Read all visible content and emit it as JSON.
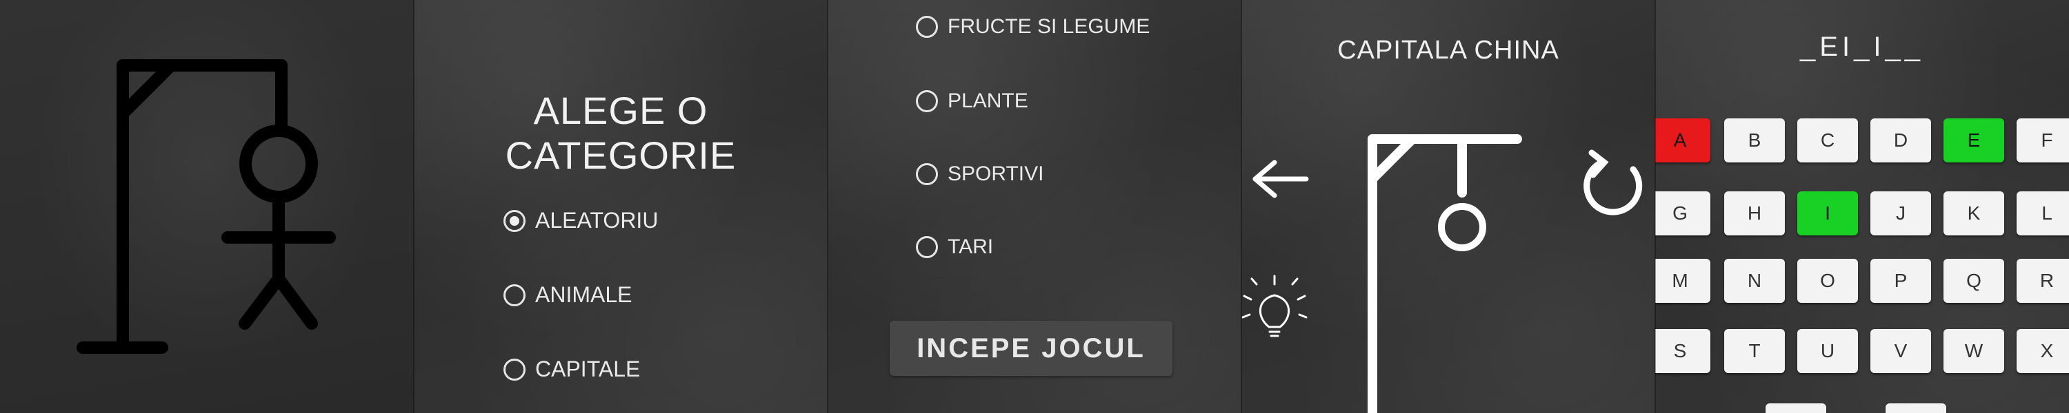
{
  "colors": {
    "chalkboard": "#333333",
    "chalk": "#f0f0f0",
    "wrong_letter": "#e8191a",
    "correct_letter": "#19d024",
    "button": "#474747"
  },
  "panel2": {
    "title": "ALEGE O CATEGORIE",
    "options": [
      {
        "label": "ALEATORIU",
        "selected": true
      },
      {
        "label": "ANIMALE",
        "selected": false
      },
      {
        "label": "CAPITALE",
        "selected": false
      }
    ]
  },
  "panel3": {
    "options": [
      {
        "label": "FRUCTE SI LEGUME"
      },
      {
        "label": "PLANTE"
      },
      {
        "label": "SPORTIVI"
      },
      {
        "label": "TARI"
      }
    ],
    "start_button": "INCEPE JOCUL"
  },
  "panel4": {
    "category_title": "CAPITALA CHINA",
    "icons": [
      "back-arrow-icon",
      "lightbulb-hint-icon",
      "restart-icon"
    ]
  },
  "panel5": {
    "word": "_EI_I__",
    "keys": [
      {
        "letter": "A",
        "state": "wrong"
      },
      {
        "letter": "B",
        "state": "default"
      },
      {
        "letter": "C",
        "state": "default"
      },
      {
        "letter": "D",
        "state": "default"
      },
      {
        "letter": "E",
        "state": "correct"
      },
      {
        "letter": "F",
        "state": "default"
      },
      {
        "letter": "G",
        "state": "default"
      },
      {
        "letter": "H",
        "state": "default"
      },
      {
        "letter": "I",
        "state": "correct"
      },
      {
        "letter": "J",
        "state": "default"
      },
      {
        "letter": "K",
        "state": "default"
      },
      {
        "letter": "L",
        "state": "default"
      },
      {
        "letter": "M",
        "state": "default"
      },
      {
        "letter": "N",
        "state": "default"
      },
      {
        "letter": "O",
        "state": "default"
      },
      {
        "letter": "P",
        "state": "default"
      },
      {
        "letter": "Q",
        "state": "default"
      },
      {
        "letter": "R",
        "state": "default"
      },
      {
        "letter": "S",
        "state": "default"
      },
      {
        "letter": "T",
        "state": "default"
      },
      {
        "letter": "U",
        "state": "default"
      },
      {
        "letter": "V",
        "state": "default"
      },
      {
        "letter": "W",
        "state": "default"
      },
      {
        "letter": "X",
        "state": "default"
      }
    ]
  }
}
